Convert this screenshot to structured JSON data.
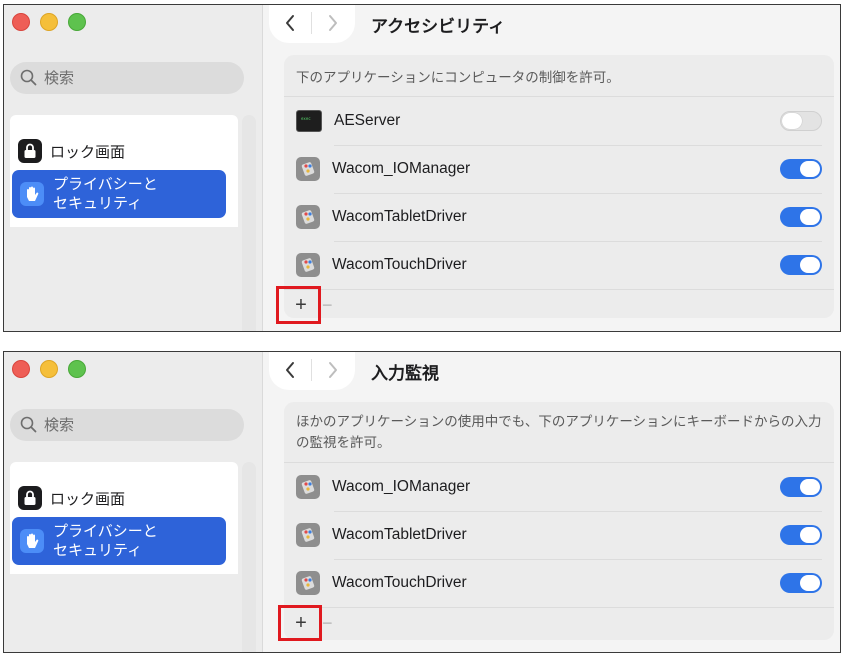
{
  "screens": [
    {
      "search_placeholder": "検索",
      "sidebar": [
        {
          "label": "ロック画面",
          "icon": "lock-icon"
        },
        {
          "label": "プライバシーと\nセキュリティ",
          "icon": "hand-icon",
          "selected": true
        }
      ],
      "title": "アクセシビリティ",
      "description": "下のアプリケーションにコンピュータの制御を許可。",
      "apps": [
        {
          "name": "AEServer",
          "icon": "terminal-icon",
          "enabled": false
        },
        {
          "name": "Wacom_IOManager",
          "icon": "wacom-icon",
          "enabled": true
        },
        {
          "name": "WacomTabletDriver",
          "icon": "wacom-icon",
          "enabled": true
        },
        {
          "name": "WacomTouchDriver",
          "icon": "wacom-icon",
          "enabled": true
        }
      ],
      "add_label": "+",
      "remove_label": "−"
    },
    {
      "search_placeholder": "検索",
      "sidebar": [
        {
          "label": "ロック画面",
          "icon": "lock-icon"
        },
        {
          "label": "プライバシーと\nセキュリティ",
          "icon": "hand-icon",
          "selected": true
        }
      ],
      "title": "入力監視",
      "description": "ほかのアプリケーションの使用中でも、下のアプリケーションにキーボードからの入力の監視を許可。",
      "apps": [
        {
          "name": "Wacom_IOManager",
          "icon": "wacom-icon",
          "enabled": true
        },
        {
          "name": "WacomTabletDriver",
          "icon": "wacom-icon",
          "enabled": true
        },
        {
          "name": "WacomTouchDriver",
          "icon": "wacom-icon",
          "enabled": true
        }
      ],
      "add_label": "+",
      "remove_label": "−"
    }
  ],
  "colors": {
    "accent": "#2e63d9",
    "toggle_on": "#2e74e8",
    "highlight": "#e0191f"
  }
}
